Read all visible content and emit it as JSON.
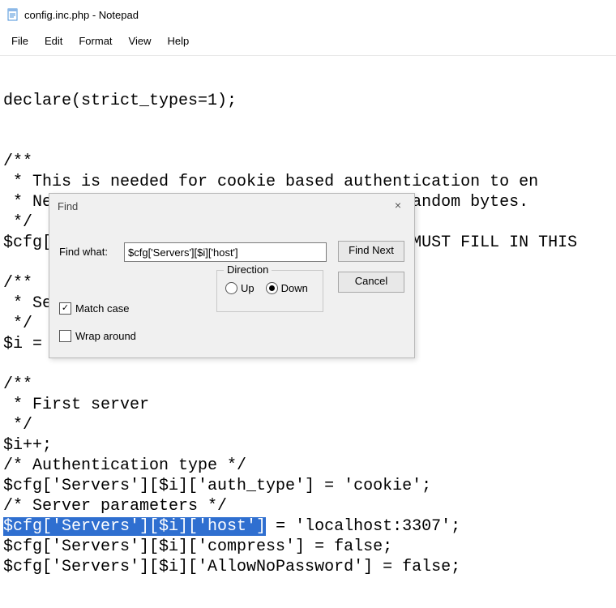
{
  "window": {
    "title": "config.inc.php - Notepad"
  },
  "menu": {
    "file": "File",
    "edit": "Edit",
    "format": "Format",
    "view": "View",
    "help": "Help"
  },
  "code": {
    "l1": "declare(strict_types=1);",
    "l2": "",
    "l3": "",
    "l4": "/**",
    "l5": " * This is needed for cookie based authentication to en",
    "l6": " * Needs to be a 32-bytes long string of random bytes.",
    "l7a": " */",
    "l8a": "$cfg[",
    "l8b": "MUST FILL IN THIS ",
    "l10": "/**",
    "l11": " * Se",
    "l12": " */",
    "l13": "$i = ",
    "l15": "/**",
    "l16": " * First server",
    "l17": " */",
    "l18": "$i++;",
    "l19": "/* Authentication type */",
    "l20": "$cfg['Servers'][$i]['auth_type'] = 'cookie';",
    "l21": "/* Server parameters */",
    "l22_sel": "$cfg['Servers'][$i]['host']",
    "l22_rest": " = 'localhost:3307';",
    "l23": "$cfg['Servers'][$i]['compress'] = false;",
    "l24": "$cfg['Servers'][$i]['AllowNoPassword'] = false;"
  },
  "find": {
    "title": "Find",
    "close": "×",
    "findwhat_label": "Find what:",
    "findwhat_value": "$cfg['Servers'][$i]['host']",
    "findnext": "Find Next",
    "cancel": "Cancel",
    "direction_label": "Direction",
    "up": "Up",
    "down": "Down",
    "matchcase": "Match case",
    "wraparound": "Wrap around"
  }
}
